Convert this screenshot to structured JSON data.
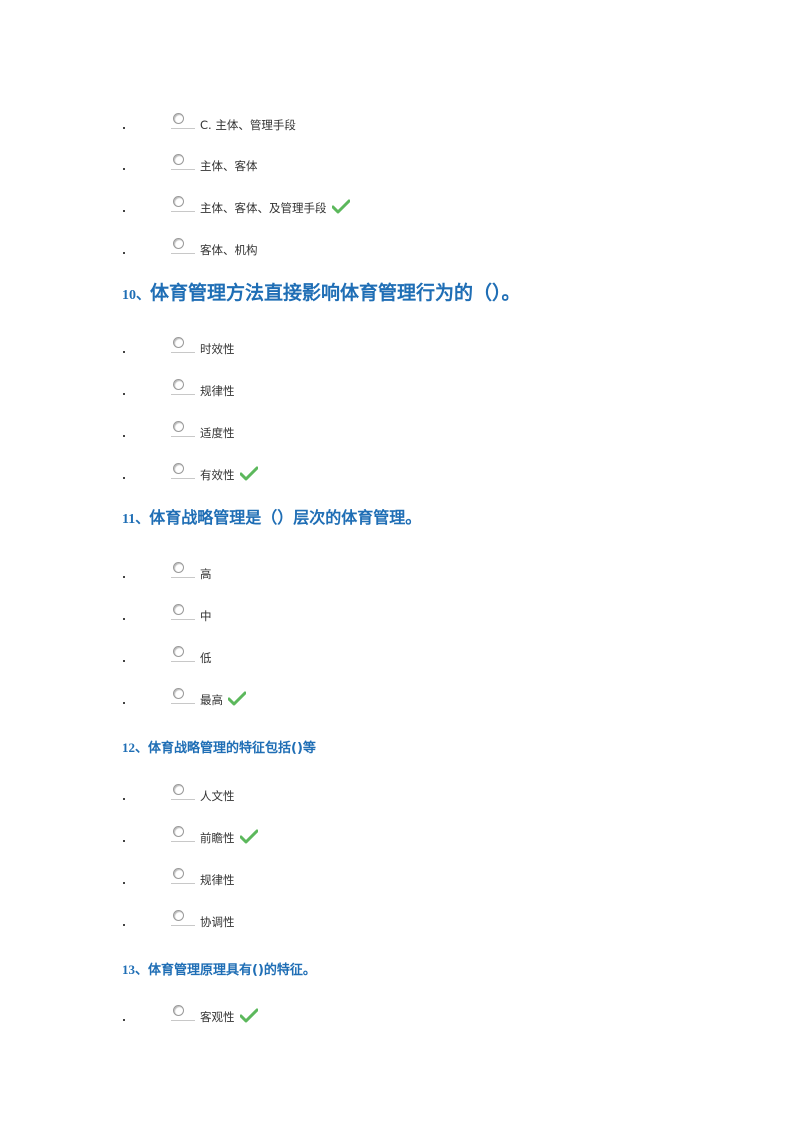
{
  "check_color": "#5cb85c",
  "question_color": "#1f6eb5",
  "blocks": [
    {
      "question": null,
      "options": [
        {
          "label": "C. 主体、管理手段",
          "correct": false
        },
        {
          "label": "主体、客体",
          "correct": false
        },
        {
          "label": "主体、客体、及管理手段",
          "correct": true
        },
        {
          "label": "客体、机构",
          "correct": false
        }
      ]
    },
    {
      "question": {
        "number": "10、",
        "text": "体育管理方法直接影响体育管理行为的（）。"
      },
      "options": [
        {
          "label": "时效性",
          "correct": false
        },
        {
          "label": "规律性",
          "correct": false
        },
        {
          "label": "适度性",
          "correct": false
        },
        {
          "label": "有效性",
          "correct": true
        }
      ]
    },
    {
      "question": {
        "number": "11、",
        "text": "体育战略管理是（）层次的体育管理。"
      },
      "options": [
        {
          "label": "高",
          "correct": false
        },
        {
          "label": "中",
          "correct": false
        },
        {
          "label": "低",
          "correct": false
        },
        {
          "label": "最高",
          "correct": true
        }
      ]
    },
    {
      "question": {
        "number": "12、",
        "text": "体育战略管理的特征包括()等"
      },
      "options": [
        {
          "label": "人文性",
          "correct": false
        },
        {
          "label": "前瞻性",
          "correct": true
        },
        {
          "label": "规律性",
          "correct": false
        },
        {
          "label": "协调性",
          "correct": false
        }
      ]
    },
    {
      "question": {
        "number": "13、",
        "text": "体育管理原理具有()的特征。"
      },
      "options": [
        {
          "label": "客观性",
          "correct": true
        }
      ]
    }
  ]
}
